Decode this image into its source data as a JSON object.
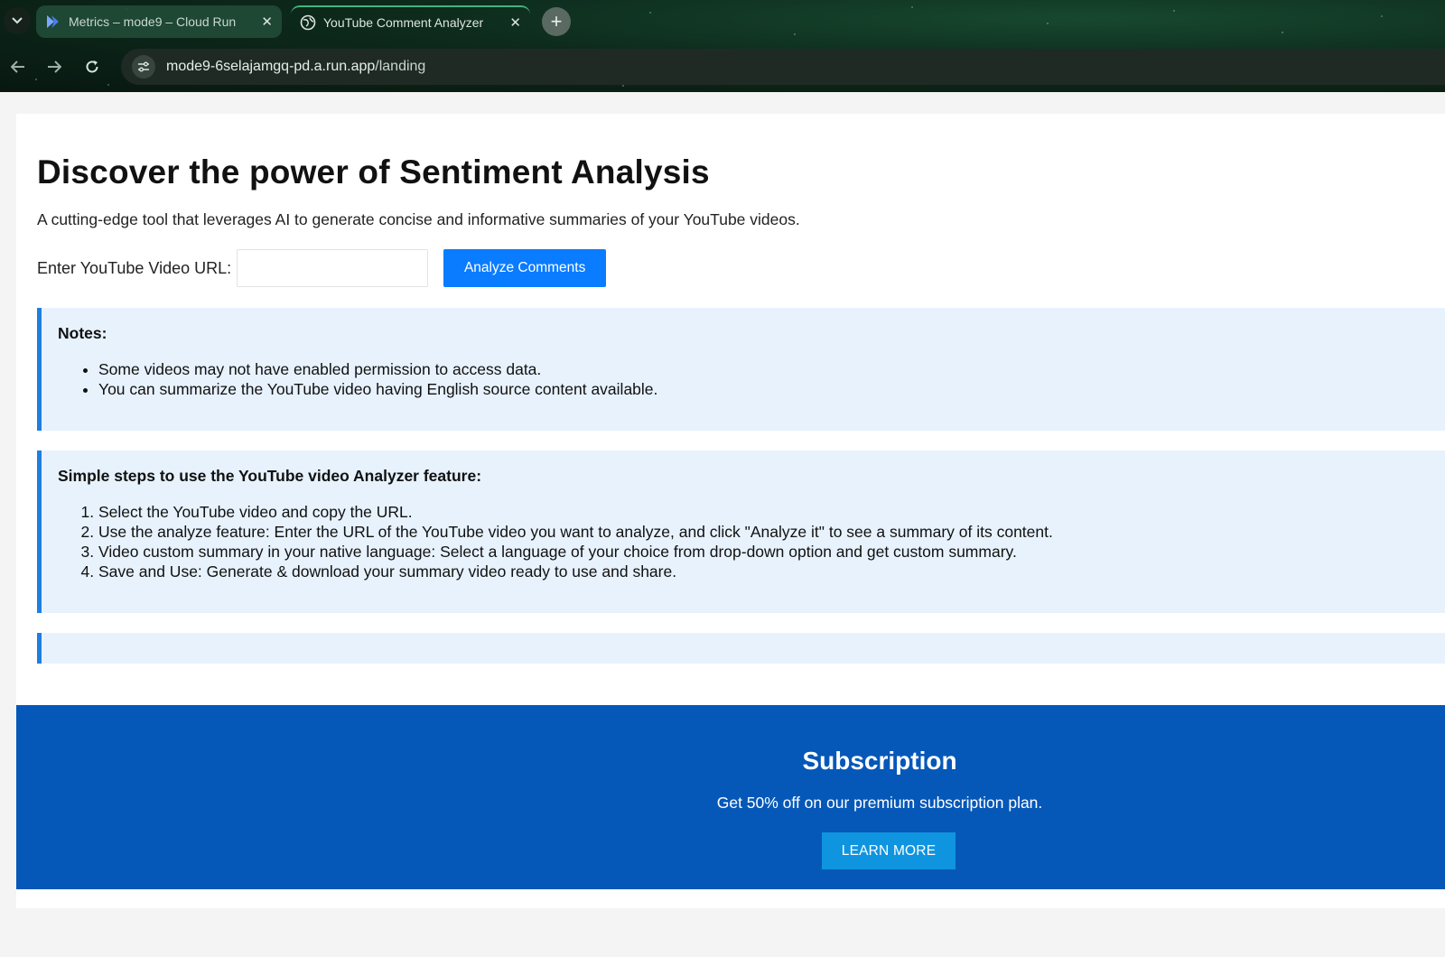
{
  "browser": {
    "tabs": [
      {
        "title": "Metrics – mode9 – Cloud Run",
        "icon": "cloud-run-icon",
        "active": false
      },
      {
        "title": "YouTube Comment Analyzer",
        "icon": "globe-icon",
        "active": true
      }
    ],
    "address_bar": {
      "host": "mode9-6selajamgq-pd.a.run.app",
      "path": "/landing"
    }
  },
  "hero": {
    "title": "Discover the power of Sentiment Analysis",
    "subtitle": "A cutting-edge tool that leverages AI to generate concise and informative summaries of your YouTube videos."
  },
  "form": {
    "label": "Enter YouTube Video URL:",
    "value": "",
    "button_label": "Analyze Comments"
  },
  "notes": {
    "heading": "Notes:",
    "items": [
      "Some videos may not have enabled permission to access data.",
      "You can summarize the YouTube video having English source content available."
    ]
  },
  "steps": {
    "heading": "Simple steps to use the YouTube video Analyzer feature:",
    "items": [
      "Select the YouTube video and copy the URL.",
      "Use the analyze feature: Enter the URL of the YouTube video you want to analyze, and click \"Analyze it\" to see a summary of its content.",
      "Video custom summary in your native language: Select a language of your choice from drop-down option and get custom summary.",
      "Save and Use: Generate & download your summary video ready to use and share."
    ]
  },
  "subscription": {
    "title": "Subscription",
    "text": "Get 50% off on our premium subscription plan.",
    "button_label": "LEARN MORE"
  },
  "colors": {
    "primary_button": "#0a7cff",
    "info_background": "#e7f2fd",
    "info_border": "#1e7fe0",
    "subscription_background": "#0558b8",
    "learn_more_button": "#0f95e0"
  }
}
